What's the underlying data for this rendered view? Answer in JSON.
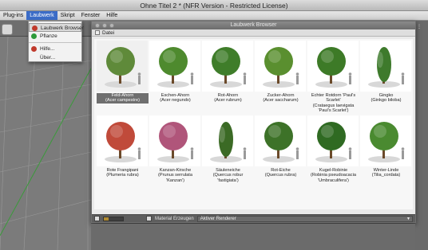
{
  "app": {
    "title": "Ohne Titel 2 * (NFR Version - Restricted License)"
  },
  "menubar": {
    "items": [
      {
        "label": "Plug-ins"
      },
      {
        "label": "Laubwerk"
      },
      {
        "label": "Skript"
      },
      {
        "label": "Fenster"
      },
      {
        "label": "Hilfe"
      }
    ],
    "active_index": 1
  },
  "dropdown": {
    "items": [
      {
        "label": "Laubwerk Browser",
        "icon": "laubwerk-browser-icon",
        "color": "#c0392b"
      },
      {
        "label": "Pflanze",
        "icon": "plant-icon",
        "color": "#2e9a3a"
      },
      {
        "label": "Hilfe...",
        "icon": "help-icon",
        "color": "#c0392b"
      },
      {
        "label": "Über...",
        "icon": "",
        "color": ""
      }
    ]
  },
  "browser": {
    "title": "Laubwerk Browser",
    "menu_label": "Datei",
    "selected_index": 0,
    "plants": [
      {
        "lines": [
          "Feld-Ahorn",
          "(Acer campestre)"
        ],
        "color": "#5f8a3a"
      },
      {
        "lines": [
          "Eschen-Ahorn",
          "(Acer negundo)"
        ],
        "color": "#4e8a2e"
      },
      {
        "lines": [
          "Rot-Ahorn",
          "(Acer rubrum)"
        ],
        "color": "#3f7d2a"
      },
      {
        "lines": [
          "Zucker-Ahorn",
          "(Acer saccharum)"
        ],
        "color": "#5a8f2f"
      },
      {
        "lines": [
          "Echter Rotdorn 'Paul's",
          "Scarlet'",
          "(Crataegus laevigata",
          "'Paul's Scarlet')"
        ],
        "color": "#3d7a27"
      },
      {
        "lines": [
          "Gingko",
          "(Ginkgo biloba)"
        ],
        "color": "#3e7a2c"
      },
      {
        "lines": [
          "Rote Frangipani",
          "(Plumeria rubra)"
        ],
        "color": "#c04a3a"
      },
      {
        "lines": [
          "Kanzan-Kirsche",
          "(Prunus serrulata",
          "'Kanzan')"
        ],
        "color": "#b0557a"
      },
      {
        "lines": [
          "Säuleneiche",
          "(Quercus robur",
          "'fastigiata')"
        ],
        "color": "#3b6a25"
      },
      {
        "lines": [
          "Rot-Eiche",
          "(Quercus rubra)"
        ],
        "color": "#3d7228"
      },
      {
        "lines": [
          "Kugel-Robinie",
          "(Robinia pseudoacacia",
          "'Umbraculifera')"
        ],
        "color": "#2f6a22"
      },
      {
        "lines": [
          "Winter-Linde",
          "(Tilia_cordata)"
        ],
        "color": "#4a8a30"
      }
    ],
    "bottom": {
      "material_label": "Material Erzeugen",
      "renderer_value": "Aktiver Renderer",
      "slider_value": 0.25
    }
  }
}
